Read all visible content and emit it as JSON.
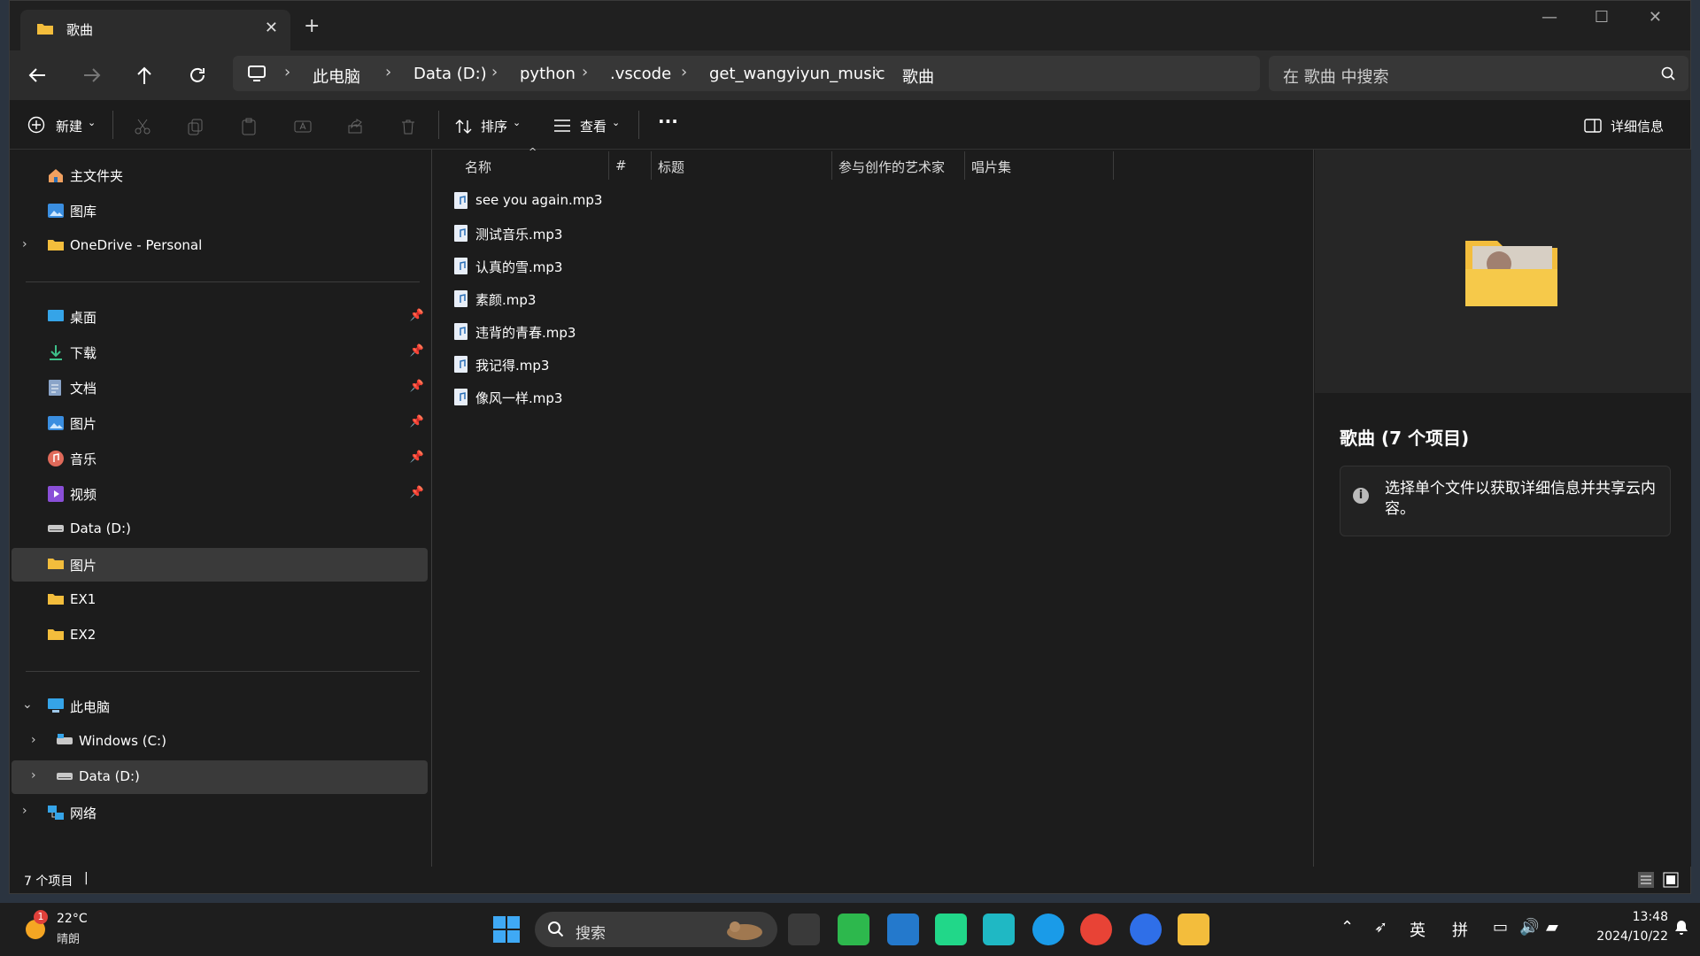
{
  "window": {
    "tab_title": "歌曲",
    "new_tab": "+",
    "close_tab": "✕"
  },
  "breadcrumb": [
    "此电脑",
    "Data (D:)",
    "python",
    ".vscode",
    "get_wangyiyun_music",
    "歌曲"
  ],
  "search": {
    "placeholder": "在 歌曲 中搜索"
  },
  "toolbar": {
    "new_label": "新建",
    "sort_label": "排序",
    "view_label": "查看",
    "more_label": "···",
    "details_label": "详细信息"
  },
  "sidebar": {
    "quick": [
      {
        "label": "主文件夹",
        "icon": "home-icon"
      },
      {
        "label": "图库",
        "icon": "gallery-icon"
      },
      {
        "label": "OneDrive - Personal",
        "icon": "folder-icon"
      }
    ],
    "pinned": [
      {
        "label": "桌面",
        "icon": "desktop-icon"
      },
      {
        "label": "下载",
        "icon": "download-icon"
      },
      {
        "label": "文档",
        "icon": "document-icon"
      },
      {
        "label": "图片",
        "icon": "pictures-icon"
      },
      {
        "label": "音乐",
        "icon": "music-icon"
      },
      {
        "label": "视频",
        "icon": "video-icon"
      },
      {
        "label": "Data (D:)",
        "icon": "drive-icon"
      },
      {
        "label": "图片",
        "icon": "folder-icon"
      },
      {
        "label": "EX1",
        "icon": "folder-icon"
      },
      {
        "label": "EX2",
        "icon": "folder-icon"
      }
    ],
    "tree": [
      {
        "label": "此电脑",
        "icon": "pc-icon"
      },
      {
        "label": "Windows (C:)",
        "icon": "drive-icon"
      },
      {
        "label": "Data (D:)",
        "icon": "drive-icon"
      },
      {
        "label": "网络",
        "icon": "network-icon"
      }
    ]
  },
  "columns": [
    "名称",
    "#",
    "标题",
    "参与创作的艺术家",
    "唱片集"
  ],
  "files": [
    "see you again.mp3",
    "测试音乐.mp3",
    "认真的雪.mp3",
    "素颜.mp3",
    "违背的青春.mp3",
    "我记得.mp3",
    "像风一样.mp3"
  ],
  "details": {
    "title": "歌曲 (7 个项目)",
    "info": "选择单个文件以获取详细信息并共享云内容。"
  },
  "status": {
    "count": "7 个项目"
  },
  "taskbar": {
    "weather_badge": "1",
    "temp": "22°C",
    "weather": "晴朗",
    "search": "搜索",
    "ime1": "英",
    "ime2": "拼",
    "time": "13:48",
    "date": "2024/10/22"
  },
  "colors": {
    "accent": "#f5c330",
    "folder": "#f3bd3c",
    "selected": "#3a3a3a"
  }
}
